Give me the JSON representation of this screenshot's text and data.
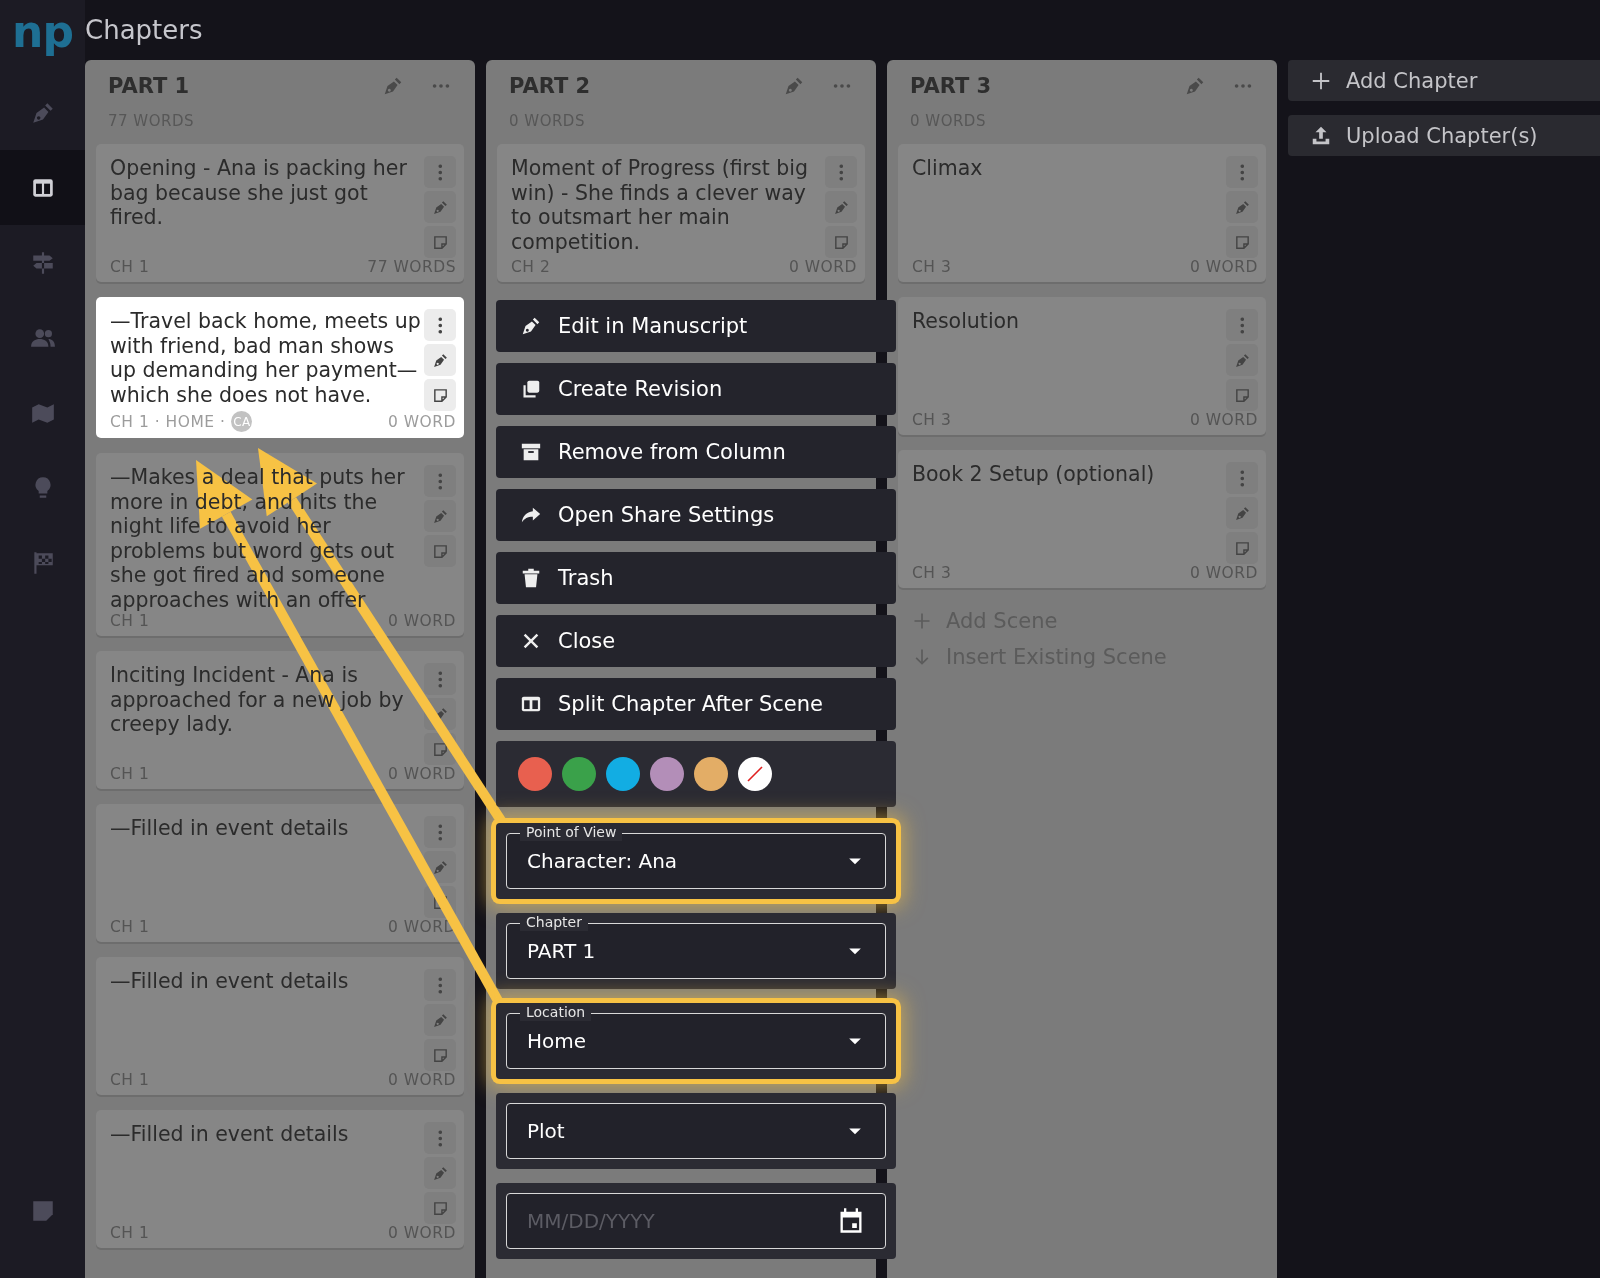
{
  "logo": "np",
  "sidebar": {
    "items": [
      {
        "selected": false
      },
      {
        "selected": true
      },
      {
        "selected": false
      },
      {
        "selected": false
      },
      {
        "selected": false
      },
      {
        "selected": false
      },
      {
        "selected": false
      }
    ]
  },
  "header": {
    "title": "Chapters"
  },
  "columns": [
    {
      "title": "PART 1",
      "words": "77 WORDS",
      "cards": [
        {
          "text": "Opening - Ana is packing her bag because she just got fired.",
          "meta": "CH 1",
          "words": "77 WORDS",
          "selected": false
        },
        {
          "text": "—Travel back home, meets up with friend, bad man shows up demanding her payment—which she does not have.",
          "meta": "CH 1 · HOME ·",
          "avatar": "CA",
          "words": "0 WORD",
          "selected": true
        },
        {
          "text": "—Makes a deal that puts her more in debt, and hits the night life to avoid her problems but word gets out she got fired and someone approaches with an offer",
          "meta": "CH 1",
          "words": "0 WORD",
          "selected": false
        },
        {
          "text": "Inciting Incident - Ana is approached for a new job by creepy lady.",
          "meta": "CH 1",
          "words": "0 WORD",
          "selected": false
        },
        {
          "text": "—Filled in event details",
          "meta": "CH 1",
          "words": "0 WORD",
          "selected": false
        },
        {
          "text": "—Filled in event details",
          "meta": "CH 1",
          "words": "0 WORD",
          "selected": false
        },
        {
          "text": "—Filled in event details",
          "meta": "CH 1",
          "words": "0 WORD",
          "selected": false
        }
      ]
    },
    {
      "title": "PART 2",
      "words": "0 WORDS",
      "cards": [
        {
          "text": "Moment of Progress (first big win) - She finds a clever way to outsmart her main competition.",
          "meta": "CH 2",
          "words": "0 WORD",
          "selected": false
        }
      ]
    },
    {
      "title": "PART 3",
      "words": "0 WORDS",
      "cards": [
        {
          "text": "Climax",
          "meta": "CH 3",
          "words": "0 WORD",
          "selected": false
        },
        {
          "text": "Resolution",
          "meta": "CH 3",
          "words": "0 WORD",
          "selected": false
        },
        {
          "text": "Book 2 Setup (optional)",
          "meta": "CH 3",
          "words": "0 WORD",
          "selected": false
        }
      ],
      "actions": [
        {
          "kind": "add",
          "label": "Add Scene"
        },
        {
          "kind": "insert",
          "label": "Insert Existing Scene"
        }
      ]
    }
  ],
  "board_actions": [
    {
      "kind": "add",
      "label": "Add Chapter"
    },
    {
      "kind": "upload",
      "label": "Upload Chapter(s)"
    }
  ],
  "context_menu": {
    "items": [
      {
        "kind": "edit",
        "label": "Edit in Manuscript"
      },
      {
        "kind": "copy",
        "label": "Create Revision"
      },
      {
        "kind": "archive",
        "label": "Remove from Column"
      },
      {
        "kind": "share",
        "label": "Open Share Settings"
      },
      {
        "kind": "trash",
        "label": "Trash"
      },
      {
        "kind": "close",
        "label": "Close"
      },
      {
        "kind": "split",
        "label": "Split Chapter After Scene"
      }
    ],
    "colors": [
      {
        "kind": "color",
        "color": "#e8604f"
      },
      {
        "kind": "color",
        "color": "#3aa14a"
      },
      {
        "kind": "color",
        "color": "#12ade3"
      },
      {
        "kind": "color",
        "color": "#b38eb8"
      },
      {
        "kind": "color",
        "color": "#e3ad66"
      },
      {
        "kind": "none"
      }
    ],
    "fields": [
      {
        "kind": "select",
        "label": "Point of View",
        "value": "Character: Ana",
        "highlighted": true
      },
      {
        "kind": "select",
        "label": "Chapter",
        "value": "PART 1",
        "highlighted": false
      },
      {
        "kind": "select",
        "label": "Location",
        "value": "Home",
        "highlighted": true
      },
      {
        "kind": "select",
        "value": "Plot",
        "highlighted": false
      },
      {
        "kind": "date",
        "placeholder": "MM/DD/YYYY",
        "highlighted": false
      }
    ]
  }
}
